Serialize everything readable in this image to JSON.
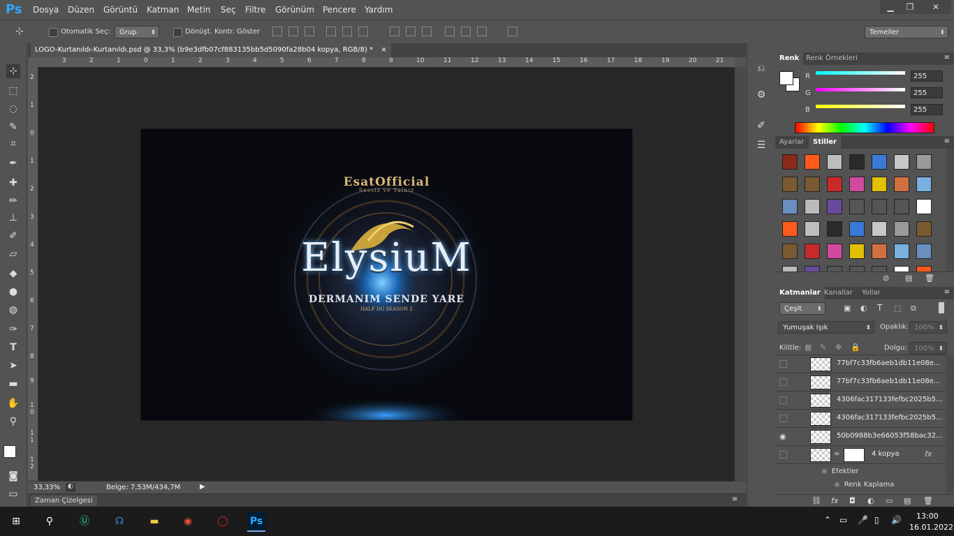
{
  "app": {
    "logo": "Ps"
  },
  "menu": [
    "Dosya",
    "Düzen",
    "Görüntü",
    "Katman",
    "Metin",
    "Seç",
    "Filtre",
    "Görünüm",
    "Pencere",
    "Yardım"
  ],
  "window_controls": {
    "minimize": "▁",
    "restore": "❐",
    "close": "✕"
  },
  "options": {
    "auto_select_label": "Otomatik Seç:",
    "auto_select_value": "Grup",
    "show_transform_label": "Dönüşt. Kontr. Göster",
    "workspace": "Temeller"
  },
  "document": {
    "tab_title": "LOGO-Kurtanıldı-Kurtanıldı.psd @ 33,3% (b9e3dfb07cf883135bb5d5090fa28b04 kopya, RGB/8) *",
    "close": "×",
    "ruler_top": [
      "3",
      "2",
      "1",
      "0",
      "1",
      "2",
      "3",
      "4",
      "5",
      "6",
      "7",
      "8",
      "9",
      "10",
      "11",
      "12",
      "13",
      "14",
      "15",
      "16",
      "17",
      "18",
      "19",
      "20",
      "21"
    ],
    "ruler_left": [
      "2",
      "1",
      "0",
      "1",
      "2",
      "3",
      "4",
      "5",
      "6",
      "7",
      "8",
      "9",
      "1 0",
      "1 1",
      "1 2"
    ],
    "artwork": {
      "brand_top": "EsatOfficial",
      "brand_sub": "Sessiz ve Yalnız",
      "title": "ElysiuM",
      "slogan": "DERMANIM SENDE YARE",
      "season": "HALF DG SEASON 2"
    }
  },
  "status": {
    "zoom": "33,33%",
    "doc_size": "Belge: 7,53M/434,7M"
  },
  "timeline": {
    "label": "Zaman Çizelgesi"
  },
  "color_panel": {
    "tabs": [
      "Renk",
      "Renk Örnekleri"
    ],
    "channels": [
      {
        "name": "R",
        "value": "255",
        "gradient": "#00ffff"
      },
      {
        "name": "G",
        "value": "255",
        "gradient": "#ff00ff"
      },
      {
        "name": "B",
        "value": "255",
        "gradient": "#ffff00"
      }
    ]
  },
  "styles_panel": {
    "tabs": [
      "Ayarlar",
      "Stiller"
    ]
  },
  "layers_panel": {
    "tabs": [
      "Katmanlar",
      "Kanallar",
      "Yollar"
    ],
    "filter": "Çeşit",
    "blend": "Yumuşak Işık",
    "opacity_label": "Opaklık:",
    "opacity_value": "100%",
    "lock_label": "Kilitle:",
    "fill_label": "Dolgu:",
    "fill_value": "100%",
    "layers": [
      {
        "name": "77bf7c33fb6aeb1db11e08e...",
        "visible": false
      },
      {
        "name": "77bf7c33fb6aeb1db11e08e...",
        "visible": false
      },
      {
        "name": "4306fac317133fefbc2025b5...",
        "visible": false
      },
      {
        "name": "4306fac317133fefbc2025b5...",
        "visible": false
      },
      {
        "name": "50b0988b3e66053f58bac32...",
        "visible": true
      },
      {
        "name": "4 kopya",
        "visible": false
      }
    ],
    "effects_label": "Efektler",
    "effect_item": "Renk Kaplama",
    "fx": "fx"
  },
  "taskbar": {
    "time": "13:00",
    "date": "16.01.2022"
  }
}
